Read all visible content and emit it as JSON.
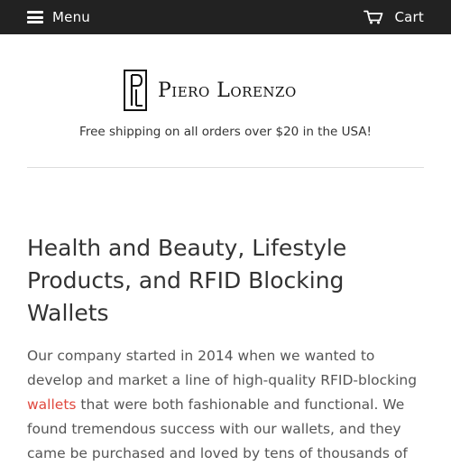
{
  "header": {
    "menu_label": "Menu",
    "cart_label": "Cart",
    "menu_icon": "hamburger-icon",
    "cart_icon": "shopping-cart-icon"
  },
  "logo": {
    "text": "Piero Lorenzo",
    "mark_icon": "pl-monogram-logo"
  },
  "promo": {
    "text": "Free shipping on all orders over $20 in the USA!"
  },
  "main": {
    "title": "Health and Beauty, Lifestyle Products, and RFID Blocking Wallets",
    "intro_before": "Our company started in 2014 when we wanted to develop and market a line of high-quality RFID-blocking ",
    "intro_link": "wallets",
    "intro_after": " that were both fashionable and functional. We found tremendous success with our wallets, and they came be purchased and loved by tens of thousands of"
  },
  "colors": {
    "topbar_bg": "#222222",
    "link": "#e0483e",
    "text": "#333333"
  }
}
